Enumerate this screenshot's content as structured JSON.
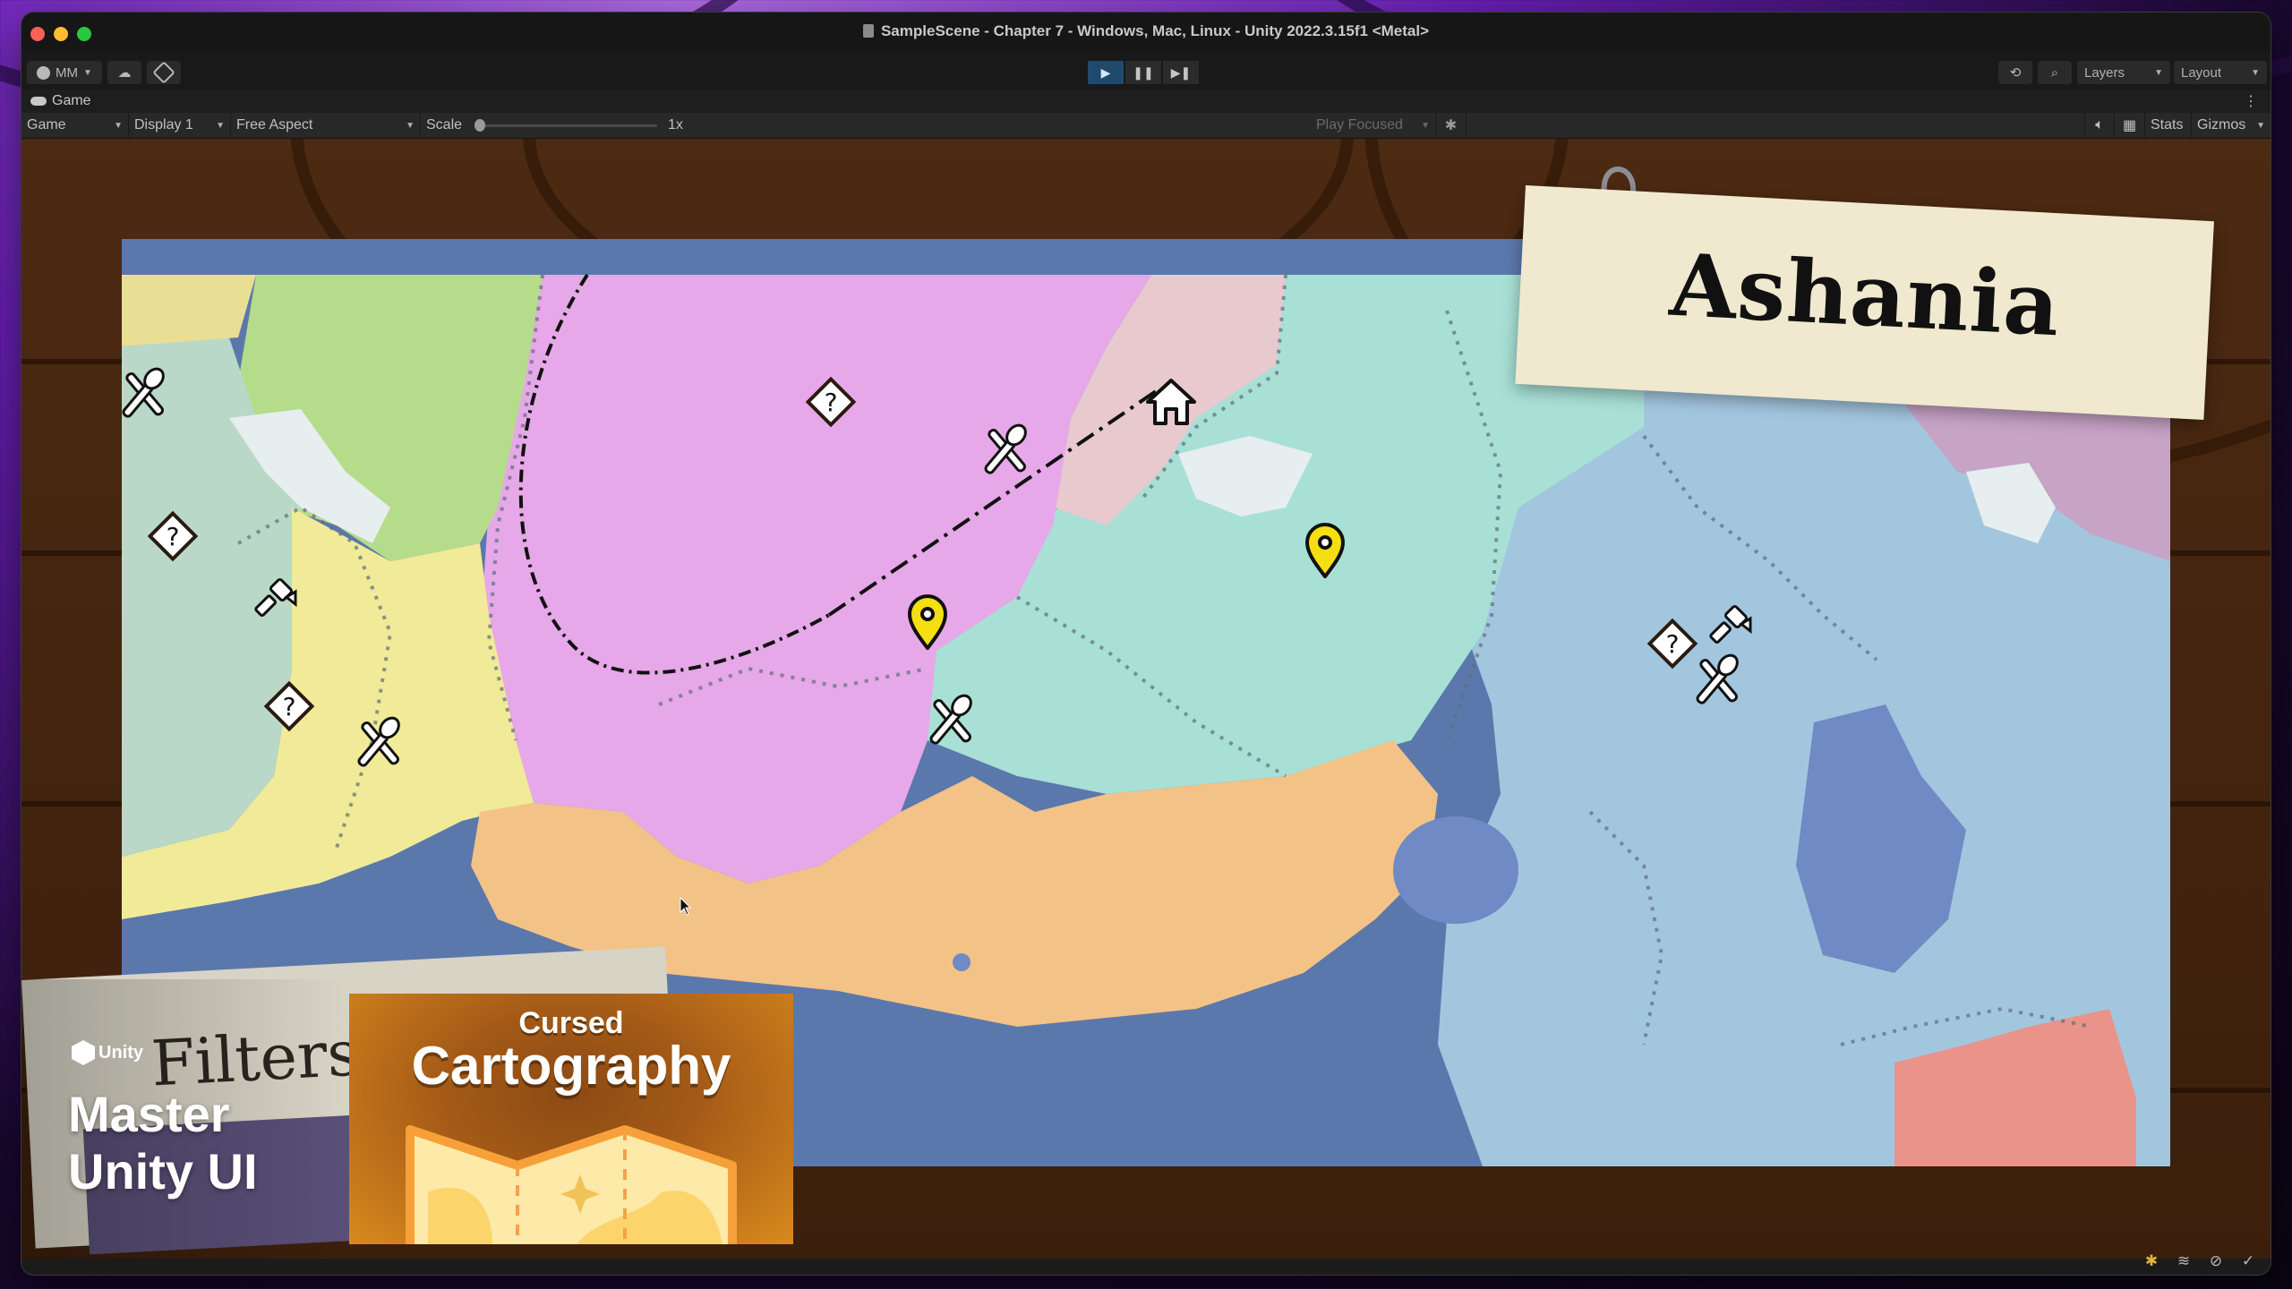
{
  "window": {
    "title": "SampleScene - Chapter 7 - Windows, Mac, Linux - Unity 2022.3.15f1 <Metal>"
  },
  "toolbar": {
    "account_label": "MM",
    "account_icon": "account-icon",
    "cloud_icon": "cloud-icon",
    "collab_icon": "unity-version-control-icon",
    "play_icon": "play-icon",
    "pause_icon": "pause-icon",
    "step_icon": "step-icon",
    "play_active": true,
    "history_icon": "undo-history-icon",
    "search_icon": "search-icon",
    "layers_label": "Layers",
    "layout_label": "Layout"
  },
  "game_tab": {
    "label": "Game",
    "icon": "gamepad-icon"
  },
  "game_toolbar": {
    "view_mode": "Game",
    "display": "Display 1",
    "aspect": "Free Aspect",
    "scale_label": "Scale",
    "scale_value": "1x",
    "play_mode": "Play Focused",
    "bug_icon": "bug-icon",
    "mute_icon": "mute-audio-icon",
    "grid_icon": "grid-icon",
    "stats_label": "Stats",
    "gizmos_label": "Gizmos"
  },
  "map": {
    "title": "Ashania",
    "regions": [
      {
        "name": "western-teal",
        "color": "#b9d8c8"
      },
      {
        "name": "northwest-yellow",
        "color": "#e8df95"
      },
      {
        "name": "green",
        "color": "#b5dc8a"
      },
      {
        "name": "central-yellow",
        "color": "#f1ea98"
      },
      {
        "name": "magenta",
        "color": "#e6a8e8"
      },
      {
        "name": "dusty-pink",
        "color": "#e8c9ce"
      },
      {
        "name": "mint",
        "color": "#a8e0d6"
      },
      {
        "name": "southern-orange",
        "color": "#f3c287"
      },
      {
        "name": "eastern-blue",
        "color": "#a3c6df"
      },
      {
        "name": "purple-northeast",
        "color": "#c7a3c6"
      },
      {
        "name": "southeast-salmon",
        "color": "#e9938a"
      },
      {
        "name": "sea",
        "color": "#5b78ac"
      }
    ],
    "markers": [
      {
        "type": "food",
        "icon": "fork-spoon-icon"
      },
      {
        "type": "quest",
        "icon": "question-diamond-icon"
      },
      {
        "type": "blacksmith",
        "icon": "hammer-icon"
      },
      {
        "type": "quest",
        "icon": "question-diamond-icon"
      },
      {
        "type": "food",
        "icon": "fork-spoon-icon"
      },
      {
        "type": "quest",
        "icon": "question-diamond-icon"
      },
      {
        "type": "food",
        "icon": "fork-spoon-icon"
      },
      {
        "type": "home",
        "icon": "house-icon"
      },
      {
        "type": "location",
        "icon": "map-pin-icon"
      },
      {
        "type": "food",
        "icon": "fork-spoon-icon"
      },
      {
        "type": "location",
        "icon": "map-pin-icon"
      },
      {
        "type": "quest",
        "icon": "question-diamond-icon"
      },
      {
        "type": "blacksmith",
        "icon": "hammer-icon"
      },
      {
        "type": "food",
        "icon": "fork-spoon-icon"
      }
    ]
  },
  "background_paper": {
    "label": "Filters"
  },
  "promo": {
    "brand": "Unity",
    "title_line1": "Master",
    "title_line2": "Unity UI",
    "card_subtitle": "Cursed",
    "card_title": "Cartography"
  },
  "statusbar": {
    "icons": [
      "console-warning-icon",
      "cache-server-icon",
      "auto-generate-lighting-icon",
      "checkmark-icon"
    ]
  }
}
